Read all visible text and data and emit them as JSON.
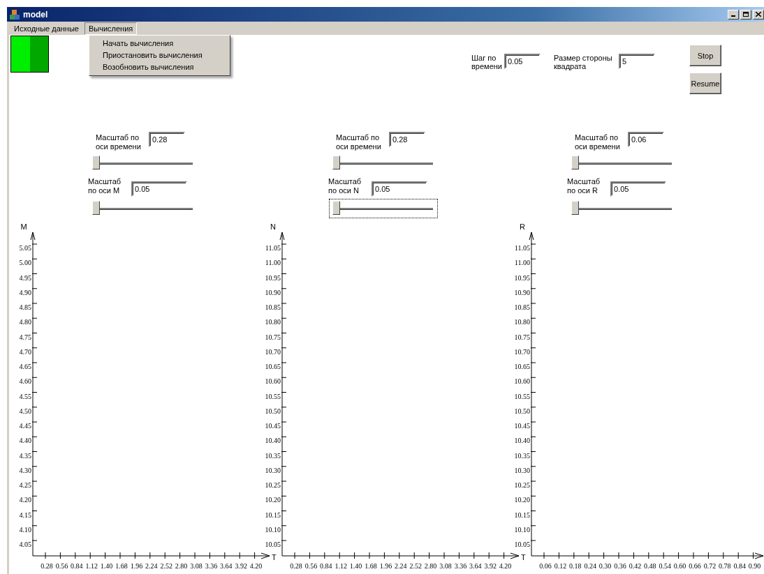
{
  "window": {
    "title": "model"
  },
  "menu_bar": [
    {
      "label": "Исходные данные",
      "selected": false
    },
    {
      "label": "Вычисления",
      "selected": true,
      "items": [
        "Начать вычисления",
        "Приостановить вычисления",
        "Возобновить вычисления"
      ]
    }
  ],
  "settings": [
    {
      "label": "Шаг по времени",
      "value": "0.05"
    },
    {
      "label": "Размер стороны квадрата",
      "value": "5"
    }
  ],
  "buttons": [
    "Stop",
    "Resume"
  ],
  "scale_groups": [
    {
      "time_label": "Масштаб по оси времени",
      "time_value": "0.28",
      "time_slider": {
        "level": 0,
        "focused": false
      },
      "axis_label": "Масштаб по оси M",
      "axis_value": "0.05",
      "axis_slider": {
        "level": 0,
        "focused": false
      }
    },
    {
      "time_label": "Масштаб по оси времени",
      "time_value": "0.28",
      "time_slider": {
        "level": 0,
        "focused": false
      },
      "axis_label": "Масштаб по оси N",
      "axis_value": "0.05",
      "axis_slider": {
        "level": 0,
        "focused": true
      }
    },
    {
      "time_label": "Масштаб по оси времени",
      "time_value": "0.06",
      "time_slider": {
        "level": 0,
        "focused": false
      },
      "axis_label": "Масштаб по оси R",
      "axis_value": "0.05",
      "axis_slider": {
        "level": 0,
        "focused": false
      }
    }
  ],
  "plots": [
    {
      "y_axis_label": "M",
      "x_axis_label": "T",
      "y_ticks": [
        "5.05",
        "5.00",
        "4.95",
        "4.90",
        "4.85",
        "4.80",
        "4.75",
        "4.70",
        "4.65",
        "4.60",
        "4.55",
        "4.50",
        "4.45",
        "4.40",
        "4.35",
        "4.30",
        "4.25",
        "4.20",
        "4.15",
        "4.10",
        "4.05"
      ],
      "x_ticks": [
        "0.28",
        "0.56",
        "0.84",
        "1.12",
        "1.40",
        "1.68",
        "1.96",
        "2.24",
        "2.52",
        "2.80",
        "3.08",
        "3.36",
        "3.64",
        "3.92",
        "4.20"
      ]
    },
    {
      "y_axis_label": "N",
      "x_axis_label": "T",
      "y_ticks": [
        "11.05",
        "11.00",
        "10.95",
        "10.90",
        "10.85",
        "10.80",
        "10.75",
        "10.70",
        "10.65",
        "10.60",
        "10.55",
        "10.50",
        "10.45",
        "10.40",
        "10.35",
        "10.30",
        "10.25",
        "10.20",
        "10.15",
        "10.10",
        "10.05"
      ],
      "x_ticks": [
        "0.28",
        "0.56",
        "0.84",
        "1.12",
        "1.40",
        "1.68",
        "1.96",
        "2.24",
        "2.52",
        "2.80",
        "3.08",
        "3.36",
        "3.64",
        "3.92",
        "4.20"
      ]
    },
    {
      "y_axis_label": "R",
      "y_ticks": [
        "11.05",
        "11.00",
        "10.95",
        "10.90",
        "10.85",
        "10.80",
        "10.75",
        "10.70",
        "10.65",
        "10.60",
        "10.55",
        "10.50",
        "10.45",
        "10.40",
        "10.35",
        "10.30",
        "10.25",
        "10.20",
        "10.15",
        "10.10",
        "10.05"
      ],
      "x_ticks": [
        "0.06",
        "0.12",
        "0.18",
        "0.24",
        "0.30",
        "0.36",
        "0.42",
        "0.48",
        "0.54",
        "0.60",
        "0.66",
        "0.72",
        "0.78",
        "0.84",
        "0.90"
      ]
    }
  ]
}
